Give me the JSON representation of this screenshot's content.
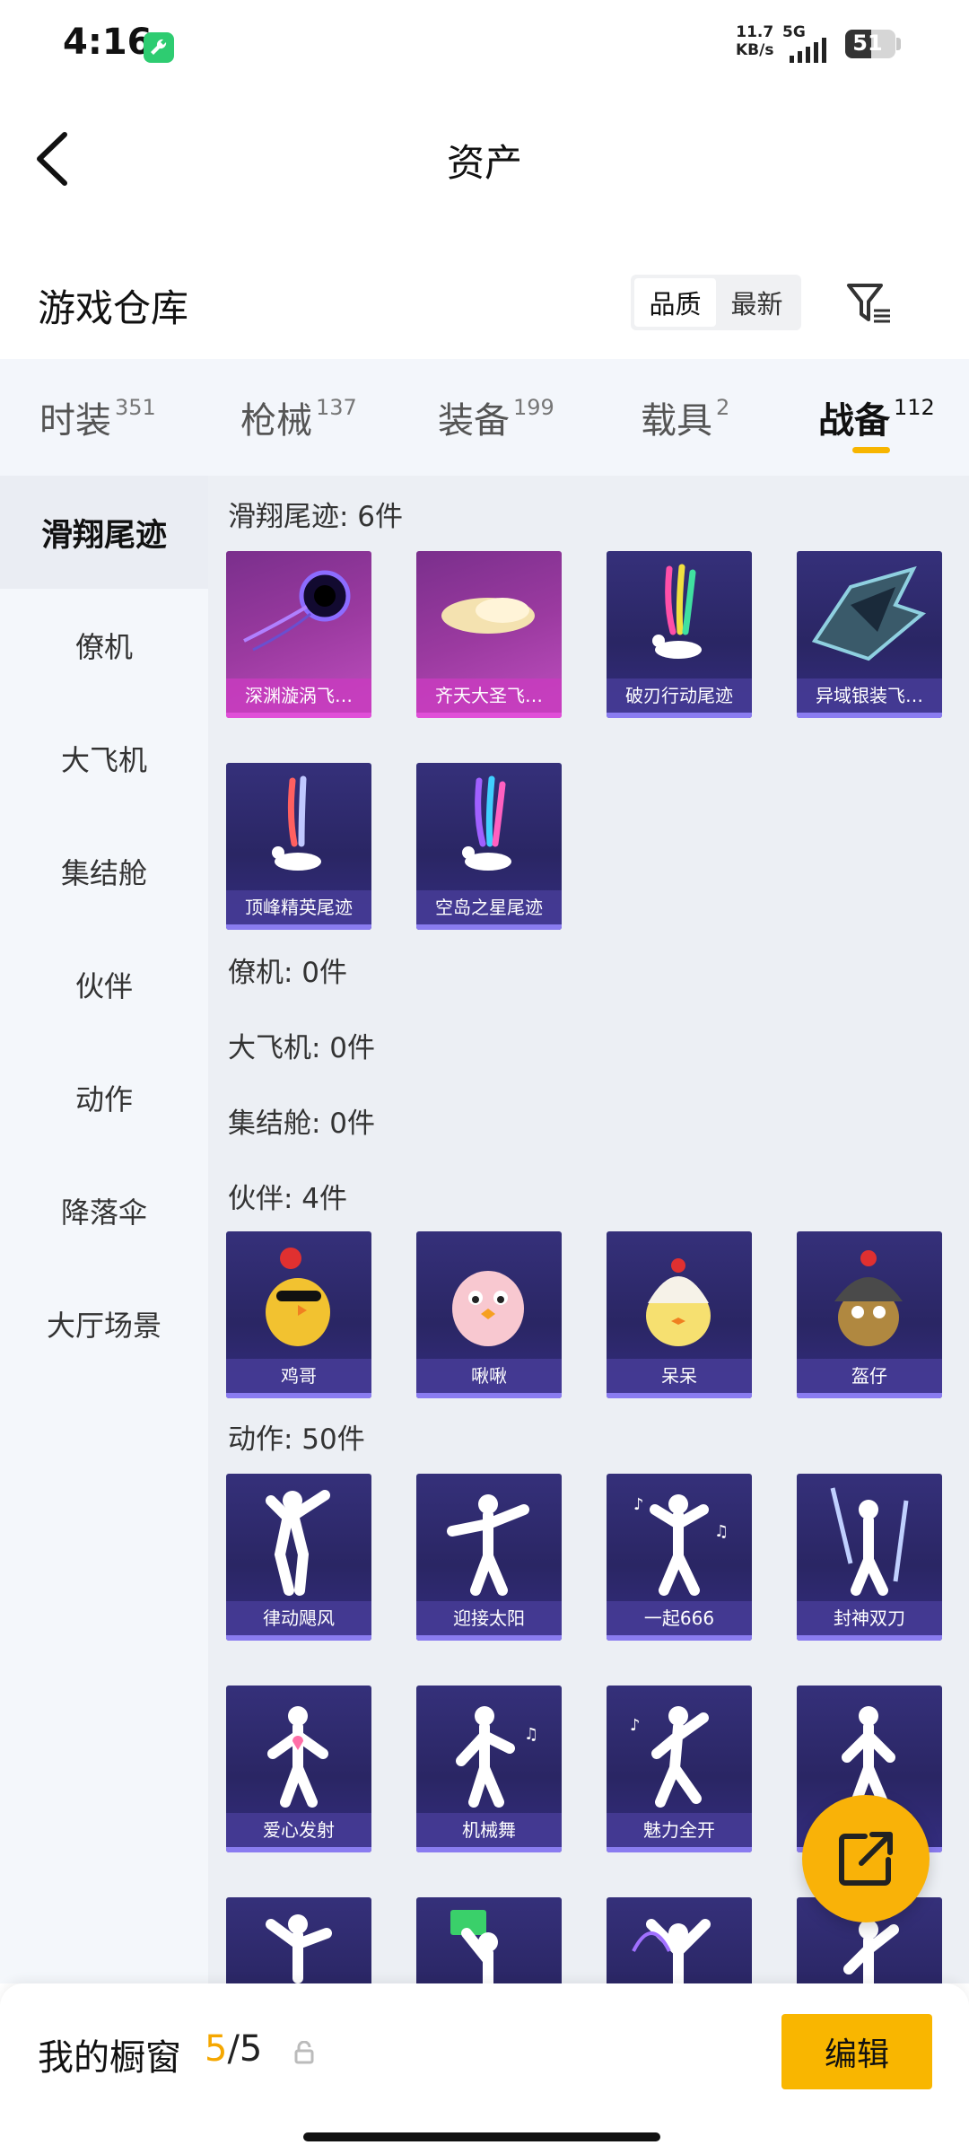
{
  "status": {
    "time": "4:16",
    "net_speed_value": "11.7",
    "net_speed_unit": "KB/s",
    "network_type": "5G",
    "battery": "51",
    "battery_level": 0.51
  },
  "header": {
    "title": "资产"
  },
  "section": {
    "title": "游戏仓库",
    "sort_options": [
      "品质",
      "最新"
    ],
    "active_sort": "品质"
  },
  "tabs": [
    {
      "label": "时装",
      "count": "351"
    },
    {
      "label": "枪械",
      "count": "137"
    },
    {
      "label": "装备",
      "count": "199"
    },
    {
      "label": "载具",
      "count": "2"
    },
    {
      "label": "战备",
      "count": "112",
      "active": true
    }
  ],
  "sidebar": {
    "items": [
      "滑翔尾迹",
      "僚机",
      "大飞机",
      "集结舱",
      "伙伴",
      "动作",
      "降落伞",
      "大厅场景"
    ],
    "active": "滑翔尾迹"
  },
  "groups": {
    "glide": {
      "title": "滑翔尾迹: 6件",
      "items": [
        "深渊漩涡飞…",
        "齐天大圣飞…",
        "破刃行动尾迹",
        "异域银装飞…",
        "顶峰精英尾迹",
        "空岛之星尾迹"
      ]
    },
    "wingman": {
      "title": "僚机: 0件"
    },
    "plane": {
      "title": "大飞机: 0件"
    },
    "capsule": {
      "title": "集结舱: 0件"
    },
    "partner": {
      "title": "伙伴: 4件",
      "items": [
        "鸡哥",
        "啾啾",
        "呆呆",
        "盔仔"
      ]
    },
    "emote": {
      "title": "动作: 50件",
      "items": [
        "律动飓风",
        "迎接太阳",
        "一起666",
        "封神双刀",
        "爱心发射",
        "机械舞",
        "魅力全开"
      ]
    }
  },
  "showcase": {
    "label": "我的橱窗",
    "used": "5",
    "total": "/5"
  },
  "edit_button": "编辑",
  "colors": {
    "accent": "#f9b208",
    "card_blue": "#2a2664",
    "card_pink": "#a63da8"
  }
}
